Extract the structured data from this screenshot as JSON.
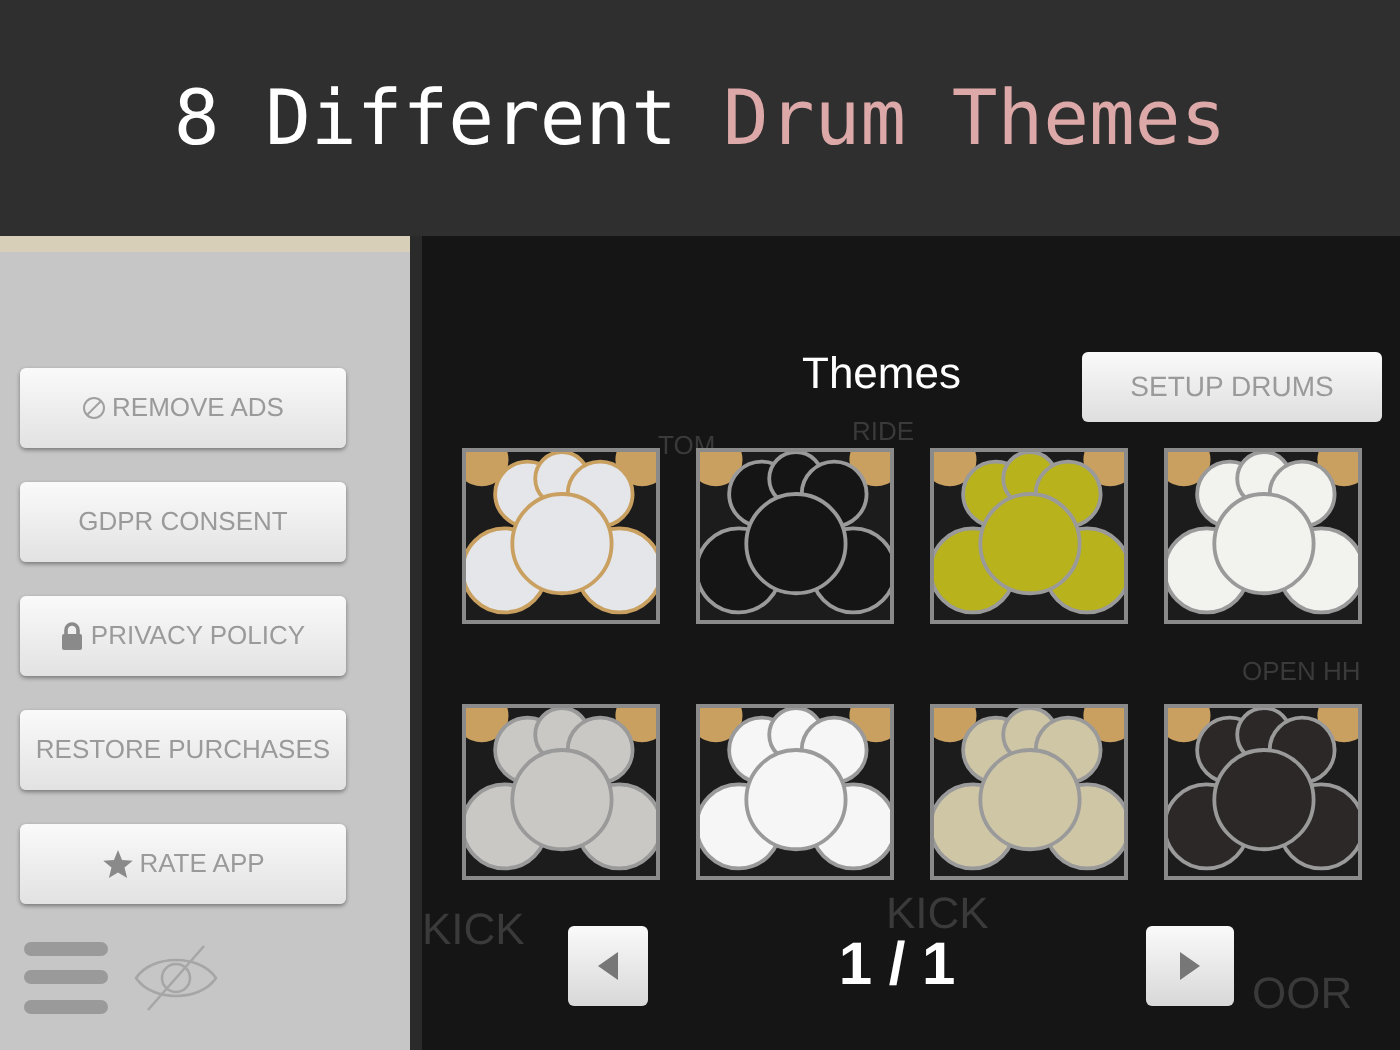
{
  "banner": {
    "title": [
      {
        "text": "8 Different ",
        "kind": "plain"
      },
      {
        "text": "Drum Themes",
        "kind": "accent"
      }
    ]
  },
  "sidebar": {
    "buttons": [
      {
        "label": "REMOVE ADS",
        "kind": "no-ads"
      },
      {
        "label": "GDPR CONSENT",
        "kind": "plain"
      },
      {
        "label": "PRIVACY POLICY",
        "kind": "lock"
      },
      {
        "label": "RESTORE PURCHASES",
        "kind": "plain"
      },
      {
        "label": "RATE APP",
        "kind": "star"
      }
    ]
  },
  "background_labels": [
    {
      "text": "TOM"
    },
    {
      "text": "RIDE"
    },
    {
      "text": "OPEN HH"
    },
    {
      "text": "KICK"
    },
    {
      "text": "KICK"
    },
    {
      "text": "OOR"
    }
  ],
  "themes_panel": {
    "title": "Themes",
    "setup_button": "SETUP DRUMS",
    "themes": [
      {
        "color": "#e4e6ea"
      },
      {
        "color": "#151515"
      },
      {
        "color": "#b8b21c"
      },
      {
        "color": "#f2f2ee"
      },
      {
        "color": "#c9c8c4"
      },
      {
        "color": "#f6f6f6"
      },
      {
        "color": "#cfc6a6"
      },
      {
        "color": "#2c2828"
      }
    ],
    "page": "1 / 1"
  }
}
